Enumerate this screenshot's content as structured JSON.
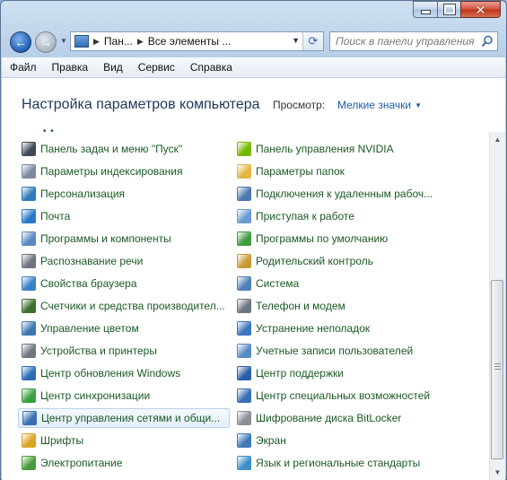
{
  "window": {
    "caption_buttons": {
      "close_glyph": "✕"
    }
  },
  "nav": {
    "breadcrumbs": [
      "Пан...",
      "Все элементы ..."
    ],
    "search_placeholder": "Поиск в панели управления"
  },
  "menu": [
    "Файл",
    "Правка",
    "Вид",
    "Сервис",
    "Справка"
  ],
  "header": {
    "title": "Настройка параметров компьютера",
    "view_label": "Просмотр:",
    "view_value": "Мелкие значки"
  },
  "items_left": [
    {
      "label": "Панель задач и меню \"Пуск\"",
      "icon": "taskbar-icon",
      "color": "#3f4a57"
    },
    {
      "label": "Параметры индексирования",
      "icon": "indexing-icon",
      "color": "#7a8aa0"
    },
    {
      "label": "Персонализация",
      "icon": "personalization-icon",
      "color": "#2e7ab8"
    },
    {
      "label": "Почта",
      "icon": "mail-icon",
      "color": "#2b78c9"
    },
    {
      "label": "Программы и компоненты",
      "icon": "programs-icon",
      "color": "#5b8ac0"
    },
    {
      "label": "Распознавание речи",
      "icon": "microphone-icon",
      "color": "#6d747e"
    },
    {
      "label": "Свойства браузера",
      "icon": "internet-options-icon",
      "color": "#3a80c5"
    },
    {
      "label": "Счетчики и средства производител...",
      "icon": "performance-icon",
      "color": "#3c6e2e"
    },
    {
      "label": "Управление цветом",
      "icon": "color-management-icon",
      "color": "#3d77b3"
    },
    {
      "label": "Устройства и принтеры",
      "icon": "printer-icon",
      "color": "#6e7682"
    },
    {
      "label": "Центр обновления Windows",
      "icon": "windows-update-icon",
      "color": "#2c6cb5"
    },
    {
      "label": "Центр синхронизации",
      "icon": "sync-icon",
      "color": "#3aa040"
    },
    {
      "label": "Центр управления сетями и общи...",
      "icon": "network-icon",
      "color": "#3b6fb0"
    },
    {
      "label": "Шрифты",
      "icon": "fonts-icon",
      "color": "#d9a424"
    },
    {
      "label": "Электропитание",
      "icon": "power-icon",
      "color": "#4a9a3a"
    }
  ],
  "items_right": [
    {
      "label": "Панель управления NVIDIA",
      "icon": "nvidia-icon",
      "color": "#76b900"
    },
    {
      "label": "Параметры папок",
      "icon": "folder-options-icon",
      "color": "#e2b641"
    },
    {
      "label": "Подключения к удаленным рабоч...",
      "icon": "remote-desktop-icon",
      "color": "#4d78b0"
    },
    {
      "label": "Приступая к работе",
      "icon": "getting-started-icon",
      "color": "#6a9ad0"
    },
    {
      "label": "Программы по умолчанию",
      "icon": "default-programs-icon",
      "color": "#3f9b3f"
    },
    {
      "label": "Родительский контроль",
      "icon": "parental-controls-icon",
      "color": "#c89b35"
    },
    {
      "label": "Система",
      "icon": "system-icon",
      "color": "#4f7fb8"
    },
    {
      "label": "Телефон и модем",
      "icon": "phone-modem-icon",
      "color": "#6b7580"
    },
    {
      "label": "Устранение неполадок",
      "icon": "troubleshooting-icon",
      "color": "#3a76c0"
    },
    {
      "label": "Учетные записи пользователей",
      "icon": "user-accounts-icon",
      "color": "#5a8ac2"
    },
    {
      "label": "Центр поддержки",
      "icon": "action-center-flag-icon",
      "color": "#2a5fa8"
    },
    {
      "label": "Центр специальных возможностей",
      "icon": "ease-of-access-icon",
      "color": "#3a6fb5"
    },
    {
      "label": "Шифрование диска BitLocker",
      "icon": "bitlocker-icon",
      "color": "#8a8f96"
    },
    {
      "label": "Экран",
      "icon": "display-icon",
      "color": "#3f78b8"
    },
    {
      "label": "Язык и региональные стандарты",
      "icon": "region-language-icon",
      "color": "#3f8fc8"
    }
  ]
}
